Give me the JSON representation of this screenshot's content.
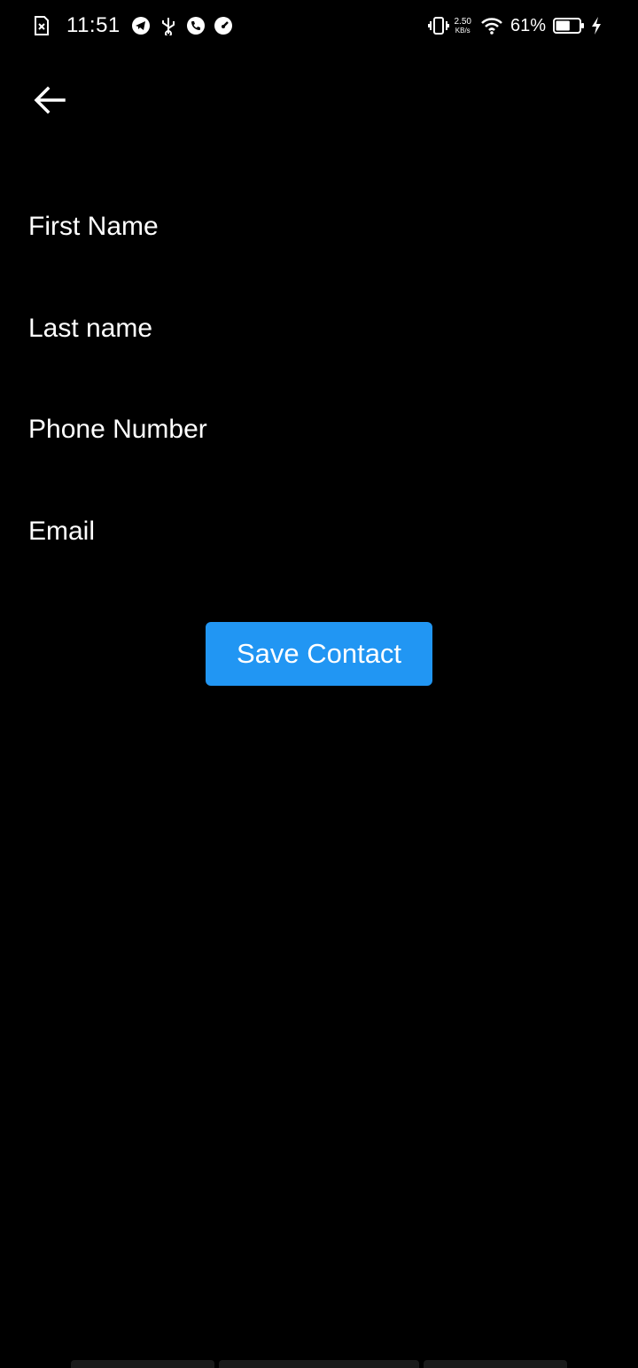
{
  "status_bar": {
    "time": "11:51",
    "net_speed_value": "2.50",
    "net_speed_unit": "KB/s",
    "battery_percent": "61%",
    "battery_level": 0.61,
    "left_icons": [
      "sim-error-icon",
      "telegram-icon",
      "usb-icon",
      "phone-call-icon",
      "speedometer-icon"
    ],
    "right_icons": [
      "vibrate-icon",
      "wifi-icon",
      "battery-icon",
      "charging-icon"
    ]
  },
  "header": {
    "back_icon": "arrow-left-icon"
  },
  "form": {
    "first_name": {
      "value": "",
      "placeholder": "First Name"
    },
    "last_name": {
      "value": "",
      "placeholder": "Last name"
    },
    "phone_number": {
      "value": "",
      "placeholder": "Phone Number"
    },
    "email": {
      "value": "",
      "placeholder": "Email"
    },
    "save_label": "Save Contact"
  },
  "colors": {
    "background": "#000000",
    "accent": "#2196F3",
    "text": "#ffffff"
  }
}
